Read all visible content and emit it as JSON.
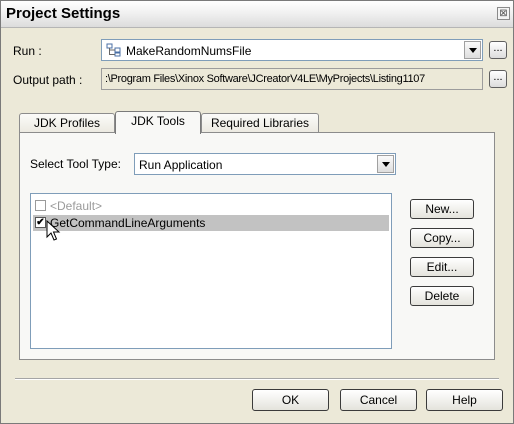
{
  "window": {
    "title": "Project Settings",
    "close_glyph": "⊠"
  },
  "run": {
    "label": "Run :",
    "value": "MakeRandomNumsFile",
    "icon": "project-tree-icon",
    "browse_label": "..."
  },
  "output": {
    "label": "Output path :",
    "value": ":\\Program Files\\Xinox Software\\JCreatorV4LE\\MyProjects\\Listing1107",
    "browse_label": "..."
  },
  "tabs": [
    {
      "label": "JDK Profiles",
      "active": false
    },
    {
      "label": "JDK Tools",
      "active": true
    },
    {
      "label": "Required Libraries",
      "active": false
    }
  ],
  "tool_type": {
    "label": "Select Tool Type:",
    "value": "Run Application"
  },
  "tools_list": [
    {
      "label": "<Default>",
      "checked": false,
      "selected": false
    },
    {
      "label": "GetCommandLineArguments",
      "checked": true,
      "selected": true
    }
  ],
  "side_buttons": {
    "new": "New...",
    "copy": "Copy...",
    "edit": "Edit...",
    "delete": "Delete"
  },
  "footer": {
    "ok": "OK",
    "cancel": "Cancel",
    "help": "Help"
  },
  "colors": {
    "dialog_bg": "#ece9d8",
    "selection": "#c2c2c2",
    "disabled_text": "#9a9a9a"
  }
}
